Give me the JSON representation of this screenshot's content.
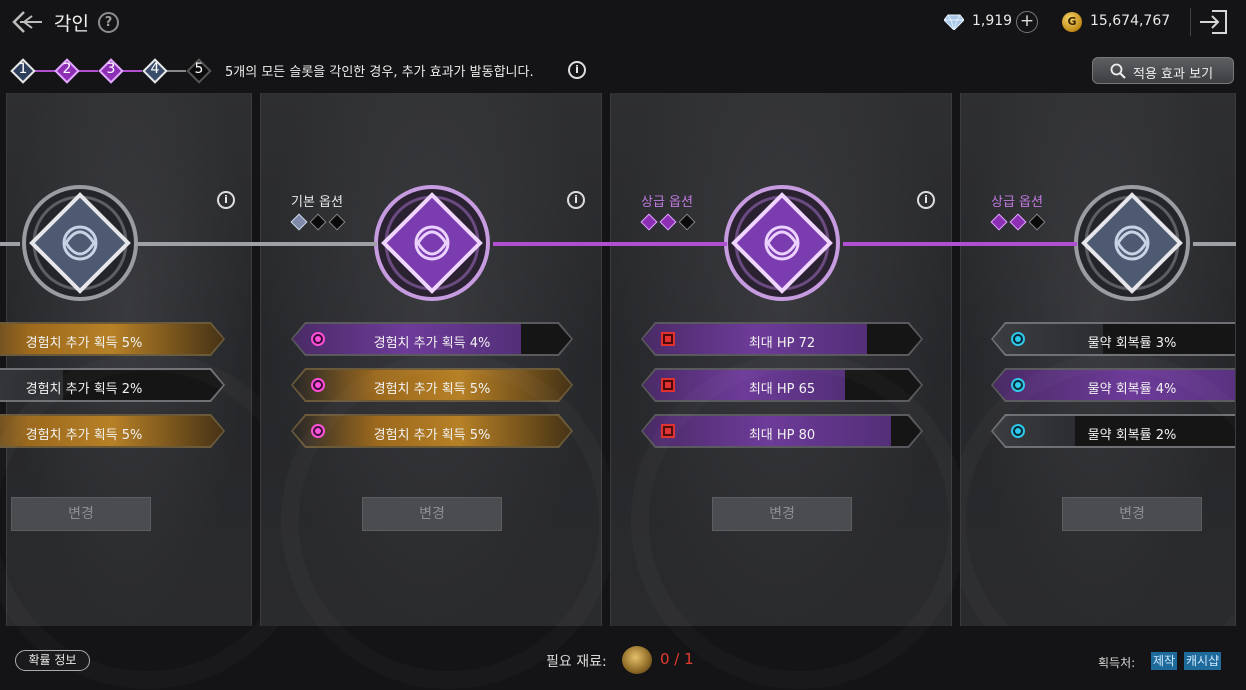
{
  "header": {
    "title": "각인",
    "help_icon": "?",
    "gems": "1,919",
    "gold": "15,674,767",
    "gold_icon": "G",
    "add_icon": "+"
  },
  "steps": {
    "items": [
      "1",
      "2",
      "3",
      "4",
      "5"
    ],
    "note": "5개의 모든 슬롯을 각인한 경우, 추가 효과가 발동합니다.",
    "info_icon": "i",
    "effect_button": "적용 효과 보기"
  },
  "panels": [
    {
      "grade_title": "",
      "info_icon": "i",
      "options": [
        {
          "text": "경험치 추가 획득 5%",
          "style": "orange"
        },
        {
          "text": "경험치 추가 획득 2%",
          "style": "gray"
        },
        {
          "text": "경험치 추가 획득 5%",
          "style": "orange"
        }
      ],
      "change_label": "변경"
    },
    {
      "grade_title": "기본 옵션",
      "info_icon": "i",
      "options": [
        {
          "text": "경험치 추가 획득 4%",
          "style": "purple"
        },
        {
          "text": "경험치 추가 획득 5%",
          "style": "orange"
        },
        {
          "text": "경험치 추가 획득 5%",
          "style": "orange"
        }
      ],
      "change_label": "변경"
    },
    {
      "grade_title": "상급 옵션",
      "info_icon": "i",
      "options": [
        {
          "text": "최대 HP 72",
          "style": "purple"
        },
        {
          "text": "최대 HP 65",
          "style": "purple"
        },
        {
          "text": "최대 HP 80",
          "style": "purple"
        }
      ],
      "change_label": "변경"
    },
    {
      "grade_title": "상급 옵션",
      "info_icon": "",
      "options": [
        {
          "text": "물약 회복률 3%",
          "style": "gray"
        },
        {
          "text": "물약 회복률 4%",
          "style": "purple"
        },
        {
          "text": "물약 회복률 2%",
          "style": "gray"
        }
      ],
      "change_label": "변경"
    }
  ],
  "footer": {
    "probability_button": "확률 정보",
    "material_label": "필요 재료:",
    "material_count": "0 / 1",
    "acquire_label": "획득처:",
    "acquire_tags": [
      "제작",
      "캐시샵"
    ]
  },
  "colors": {
    "purple_accent": "#b050d0",
    "grade_purple": "#c07adf",
    "count_red": "#e23b2e",
    "tag_blue": "#1e6a9b"
  }
}
